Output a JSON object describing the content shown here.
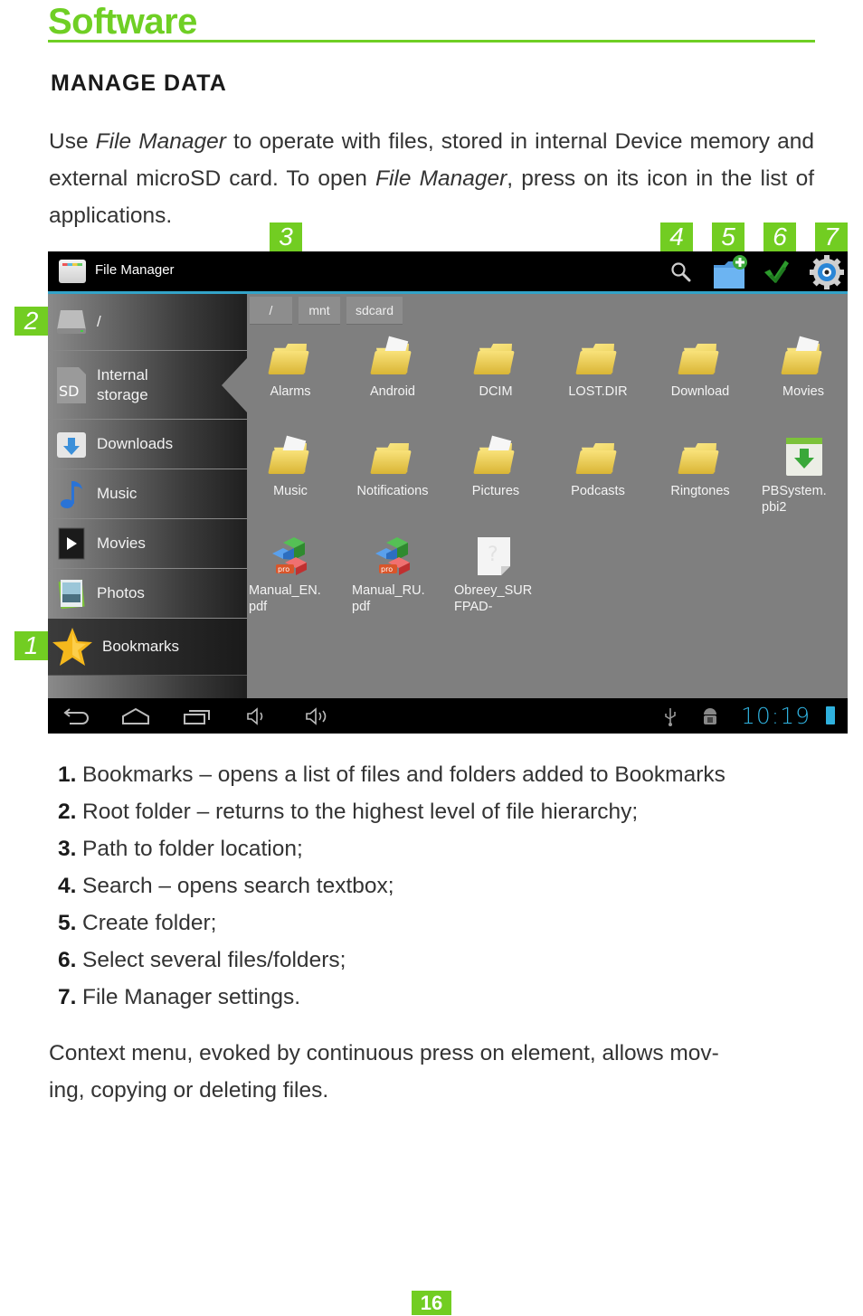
{
  "section_title": "Software",
  "heading": "MANAGE DATA",
  "intro": {
    "part1": "Use ",
    "app_name_1": "File Manager",
    "part2": " to operate with files, stored in internal Device memory and external microSD card. To open ",
    "app_name_2": "File Manager",
    "part3": ", press on its icon in the list of applications."
  },
  "callouts": [
    "1",
    "2",
    "3",
    "4",
    "5",
    "6",
    "7"
  ],
  "screenshot": {
    "app_title": "File Manager",
    "action_icons": [
      "search-icon",
      "new-folder-icon",
      "multi-select-icon",
      "settings-gear-icon"
    ],
    "sidebar": [
      {
        "label": "/",
        "icon": "drive-icon"
      },
      {
        "label": "Internal storage",
        "icon": "sd-card-icon"
      },
      {
        "label": "Downloads",
        "icon": "downloads-folder-icon"
      },
      {
        "label": "Music",
        "icon": "music-note-icon"
      },
      {
        "label": "Movies",
        "icon": "play-icon"
      },
      {
        "label": "Photos",
        "icon": "photo-icon"
      },
      {
        "label": "Bookmarks",
        "icon": "star-icon"
      }
    ],
    "breadcrumb": [
      "/",
      "mnt",
      "sdcard"
    ],
    "items": [
      {
        "name": "Alarms",
        "type": "folder"
      },
      {
        "name": "Android",
        "type": "folder-with-files"
      },
      {
        "name": "DCIM",
        "type": "folder"
      },
      {
        "name": "LOST.DIR",
        "type": "folder"
      },
      {
        "name": "Download",
        "type": "folder"
      },
      {
        "name": "Movies",
        "type": "folder-with-files"
      },
      {
        "name": "Music",
        "type": "folder-with-files"
      },
      {
        "name": "Notifications",
        "type": "folder"
      },
      {
        "name": "Pictures",
        "type": "folder-with-files"
      },
      {
        "name": "Podcasts",
        "type": "folder"
      },
      {
        "name": "Ringtones",
        "type": "folder"
      },
      {
        "name": "PBSystem.\npbi2",
        "line1": "PBSystem.",
        "line2": "pbi2",
        "type": "installer"
      },
      {
        "name": "Manual_EN.pdf",
        "line1": "Manual_EN.",
        "line2": "pdf",
        "type": "pdf"
      },
      {
        "name": "Manual_RU.pdf",
        "line1": "Manual_RU.",
        "line2": "pdf",
        "type": "pdf"
      },
      {
        "name": "Obreey_SURFPAD-",
        "line1": "Obreey_SUR",
        "line2": "FPAD-",
        "type": "unknown"
      }
    ],
    "navbar": {
      "icons": [
        "back-icon",
        "home-icon",
        "recent-apps-icon",
        "volume-down-icon",
        "volume-up-icon"
      ],
      "status_icons": [
        "usb-icon",
        "android-debug-icon",
        "battery-charging-icon"
      ],
      "clock": "10:19"
    }
  },
  "list": [
    {
      "num": "1.",
      "text": "Bookmarks – opens a list of files and folders added to Bookmarks"
    },
    {
      "num": "2.",
      "text": "Root folder – returns to the highest level of file hierarchy;"
    },
    {
      "num": "3.",
      "text": "Path to folder location;"
    },
    {
      "num": "4.",
      "text": "Search – opens search textbox;"
    },
    {
      "num": "5.",
      "text": "Create folder;"
    },
    {
      "num": "6.",
      "text": "Select several files/folders;"
    },
    {
      "num": "7.",
      "text": "File Manager settings."
    }
  ],
  "outro": "Context menu, evoked by continuous press on element, allows mov-ing, copying or deleting files.",
  "outro_line1": "Context menu, evoked by continuous press on element, allows mov-",
  "outro_line2": "ing, copying or deleting files.",
  "page_number": "16",
  "colors": {
    "accent": "#72cd22",
    "clock": "#2fb1de",
    "holo_blue": "#33a3c8"
  }
}
